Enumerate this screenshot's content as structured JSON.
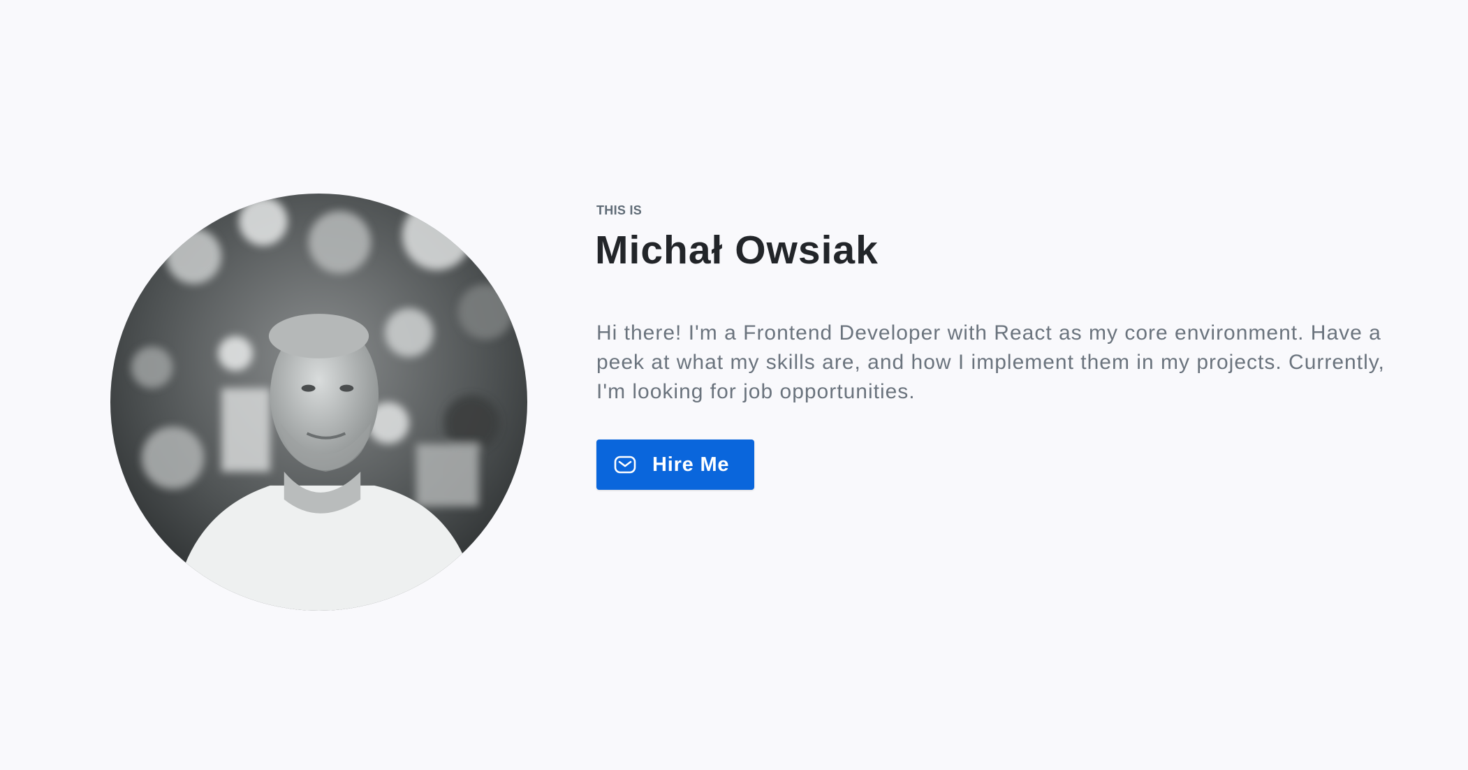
{
  "hero": {
    "eyebrow": "THIS IS",
    "name": "Michał Owsiak",
    "bio": "Hi there! I'm a Frontend Developer with React as my core environment. Have a peek at what my skills are, and how I implement them in my projects. Currently, I'm looking for job opportunities.",
    "hire_button": {
      "label": "Hire Me",
      "icon": "mail-icon"
    },
    "avatar": {
      "icon": "profile-photo"
    }
  },
  "colors": {
    "background": "#f9f9fc",
    "heading": "#222529",
    "muted_text": "#6a737d",
    "button_bg": "#0a66dc",
    "button_text": "#ffffff"
  }
}
